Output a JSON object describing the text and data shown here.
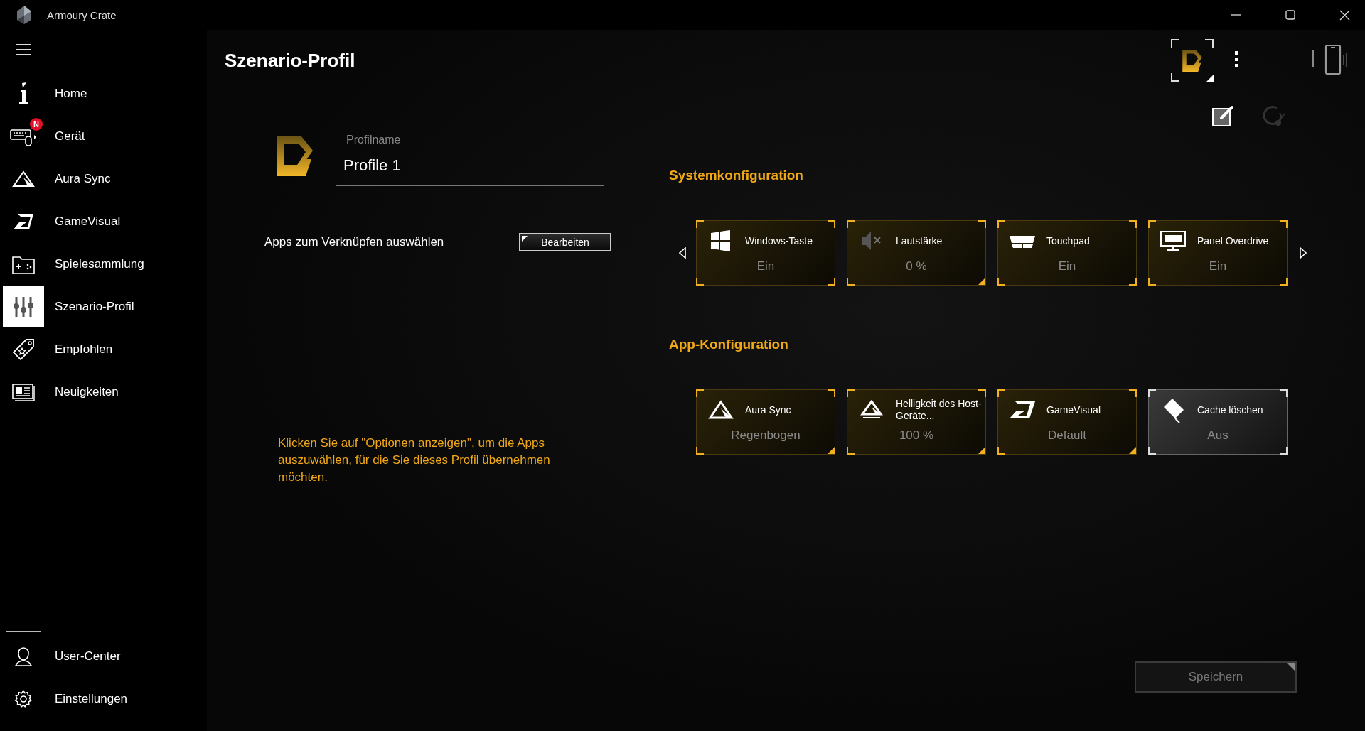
{
  "window": {
    "title": "Armoury Crate"
  },
  "sidebar": {
    "items": [
      {
        "label": "Home",
        "selected": false
      },
      {
        "label": "Gerät",
        "selected": false,
        "badge": "N"
      },
      {
        "label": "Aura Sync",
        "selected": false
      },
      {
        "label": "GameVisual",
        "selected": false
      },
      {
        "label": "Spielesammlung",
        "selected": false
      },
      {
        "label": "Szenario-Profil",
        "selected": true
      },
      {
        "label": "Empfohlen",
        "selected": false
      },
      {
        "label": "Neuigkeiten",
        "selected": false
      }
    ],
    "bottom_items": [
      {
        "label": "User-Center"
      },
      {
        "label": "Einstellungen"
      }
    ]
  },
  "page": {
    "title": "Szenario-Profil"
  },
  "profile": {
    "name_label": "Profilname",
    "name_value": "Profile 1",
    "apps_label": "Apps zum Verknüpfen auswählen",
    "edit_button": "Bearbeiten",
    "hint": "Klicken Sie auf \"Optionen anzeigen\", um die Apps auszuwählen, für die Sie dieses Profil übernehmen möchten."
  },
  "system_config": {
    "title": "Systemkonfiguration",
    "tiles": [
      {
        "label": "Windows-Taste",
        "value": "Ein",
        "active": true,
        "has_options": false
      },
      {
        "label": "Lautstärke",
        "value": "0 %",
        "active": true,
        "has_options": true
      },
      {
        "label": "Touchpad",
        "value": "Ein",
        "active": true,
        "has_options": false
      },
      {
        "label": "Panel Overdrive",
        "value": "Ein",
        "active": true,
        "has_options": false
      }
    ]
  },
  "app_config": {
    "title": "App-Konfiguration",
    "tiles": [
      {
        "label": "Aura Sync",
        "value": "Regenbogen",
        "active": true,
        "has_options": true
      },
      {
        "label": "Helligkeit des Host-Geräte...",
        "value": "100 %",
        "active": true,
        "has_options": true
      },
      {
        "label": "GameVisual",
        "value": "Default",
        "active": true,
        "has_options": true
      },
      {
        "label": "Cache löschen",
        "value": "Aus",
        "active": false,
        "has_options": false
      }
    ]
  },
  "save_button": {
    "label": "Speichern",
    "disabled": true
  }
}
